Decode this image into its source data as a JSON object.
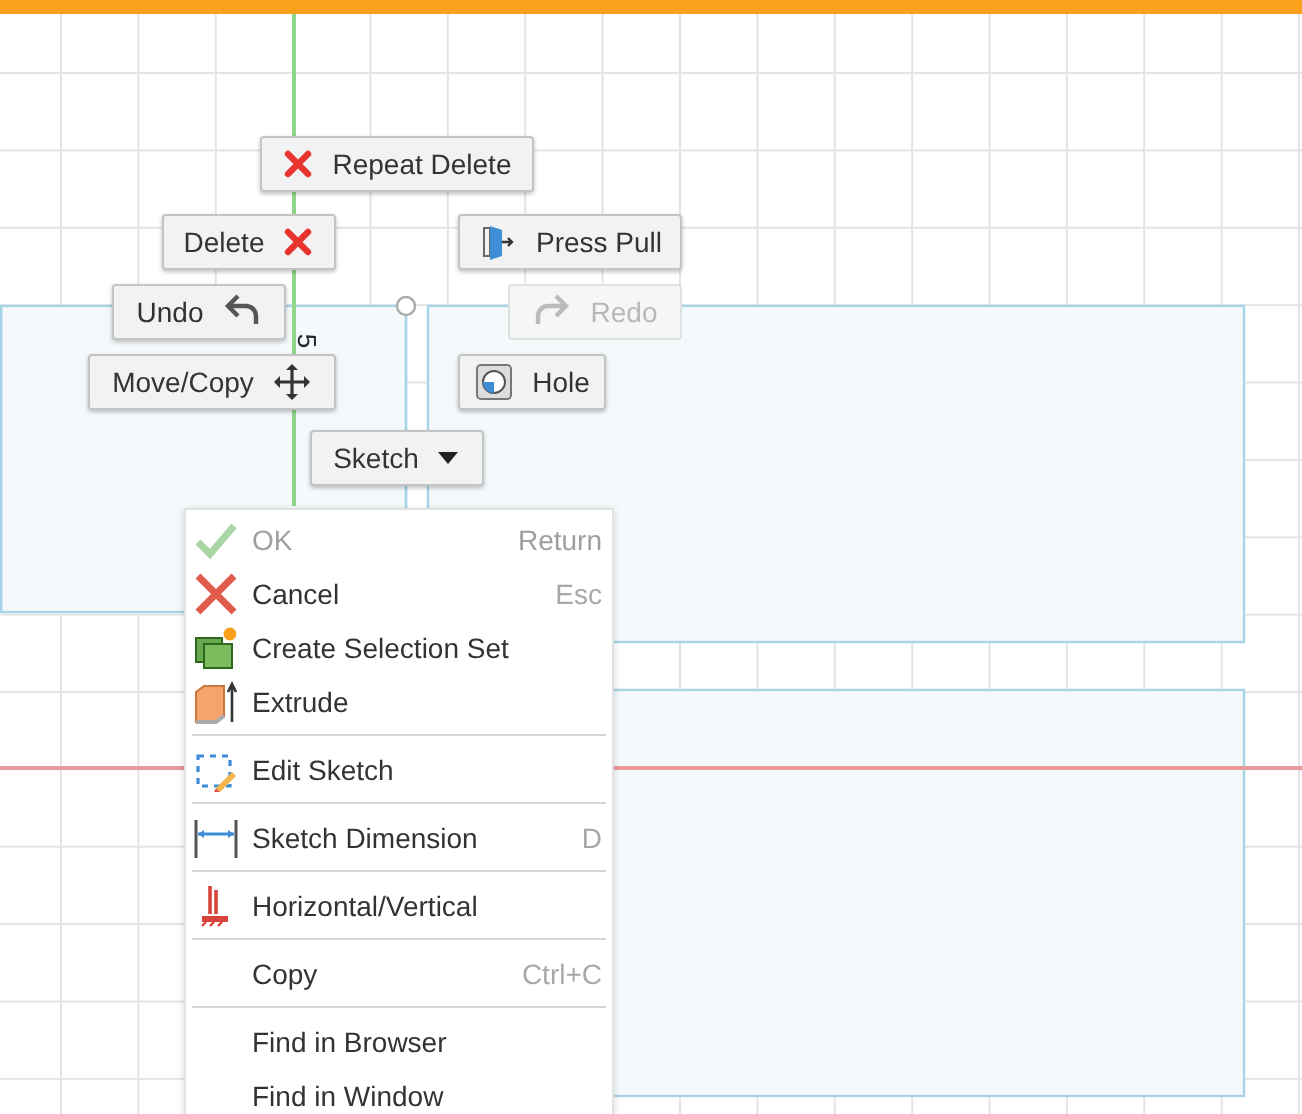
{
  "sketch": {
    "dimension": "5"
  },
  "marking_menu": [
    {
      "label": "Repeat Delete",
      "disabled": false
    },
    {
      "label": "Delete",
      "disabled": false
    },
    {
      "label": "Press Pull",
      "disabled": false
    },
    {
      "label": "Undo",
      "disabled": false
    },
    {
      "label": "Redo",
      "disabled": true
    },
    {
      "label": "Move/Copy",
      "disabled": false
    },
    {
      "label": "Hole",
      "disabled": false
    },
    {
      "label": "Sketch",
      "disabled": false
    }
  ],
  "context_menu": [
    [
      {
        "label": "OK",
        "shortcut": "Return",
        "disabled": true
      },
      {
        "label": "Cancel",
        "shortcut": "Esc",
        "disabled": false
      },
      {
        "label": "Create Selection Set",
        "disabled": false
      },
      {
        "label": "Extrude",
        "disabled": false
      }
    ],
    [
      {
        "label": "Edit Sketch",
        "disabled": false
      }
    ],
    [
      {
        "label": "Sketch Dimension",
        "shortcut": "D",
        "disabled": false
      }
    ],
    [
      {
        "label": "Horizontal/Vertical",
        "disabled": false
      }
    ],
    [
      {
        "label": "Copy",
        "shortcut": "Ctrl+C",
        "disabled": false
      }
    ],
    [
      {
        "label": "Find in Browser",
        "disabled": false
      },
      {
        "label": "Find in Window",
        "disabled": false
      }
    ]
  ]
}
